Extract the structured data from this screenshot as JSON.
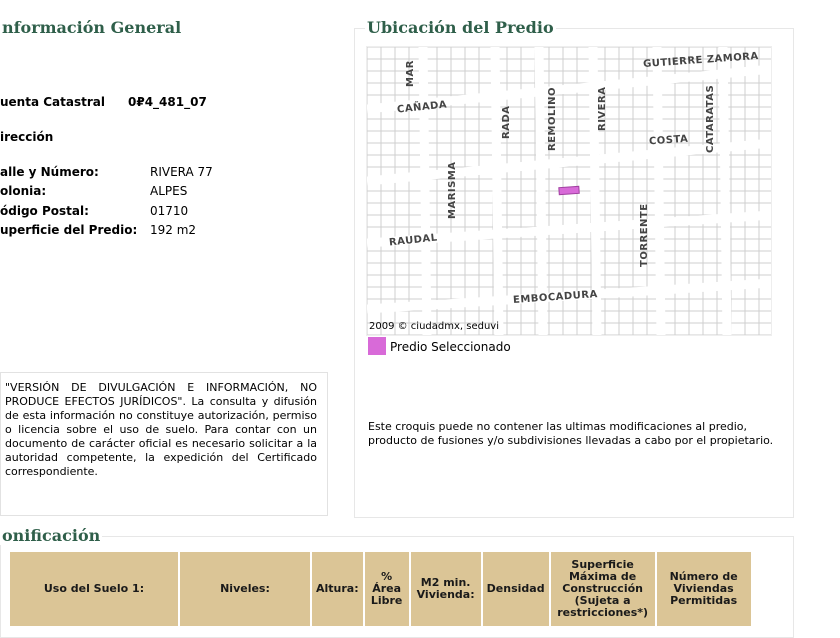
{
  "info": {
    "title": "nformación General",
    "cuenta_label": "uenta Catastral",
    "cuenta_value": "0₽4_481_07",
    "direccion_label": "irección",
    "fields": [
      {
        "label": "alle y Número:",
        "value": "RIVERA 77"
      },
      {
        "label": "olonia:",
        "value": "ALPES"
      },
      {
        "label": "ódigo Postal:",
        "value": "01710"
      },
      {
        "label": "uperficie del Predio:",
        "value": "192 m2"
      }
    ],
    "disclaimer": "\"VERSIÓN DE DIVULGACIÓN E INFORMACIÓN, NO PRODUCE EFECTOS JURÍDICOS\". La consulta y difusión de esta información no constituye autorización, permiso o licencia sobre el uso de suelo. Para contar con un documento de carácter oficial es necesario solicitar a la autoridad competente, la expedición del Certificado correspondiente."
  },
  "ubicacion": {
    "title": "Ubicación del Predio",
    "streets": {
      "mar": "MAR",
      "canada": "CAÑADA",
      "rada": "RADA",
      "remolino": "REMOLINO",
      "rivera": "RIVERA",
      "gutierre": "GUTIERRE ZAMORA",
      "cataratas": "CATARATAS",
      "costa": "COSTA",
      "marisma": "MARISMA",
      "raudal": "RAUDAL",
      "torrente": "TORRENTE",
      "embocadura": "EMBOCADURA"
    },
    "copyright": "2009 © ciudadmx, seduvi",
    "legend_label": "Predio Seleccionado",
    "legend_color": "#d86ad8",
    "note": "Este croquis puede no contener las ultimas modificaciones al predio, producto de fusiones y/o subdivisiones llevadas a cabo por el propietario."
  },
  "zonificacion": {
    "title": "onificación",
    "headers": [
      "Uso del Suelo 1:",
      "Niveles:",
      "Altura:",
      "% Área Libre",
      "M2 min. Vivienda:",
      "Densidad",
      "Superficie Máxima de Construcción (Sujeta a restricciones*)",
      "Número de Viviendas Permitidas"
    ]
  }
}
